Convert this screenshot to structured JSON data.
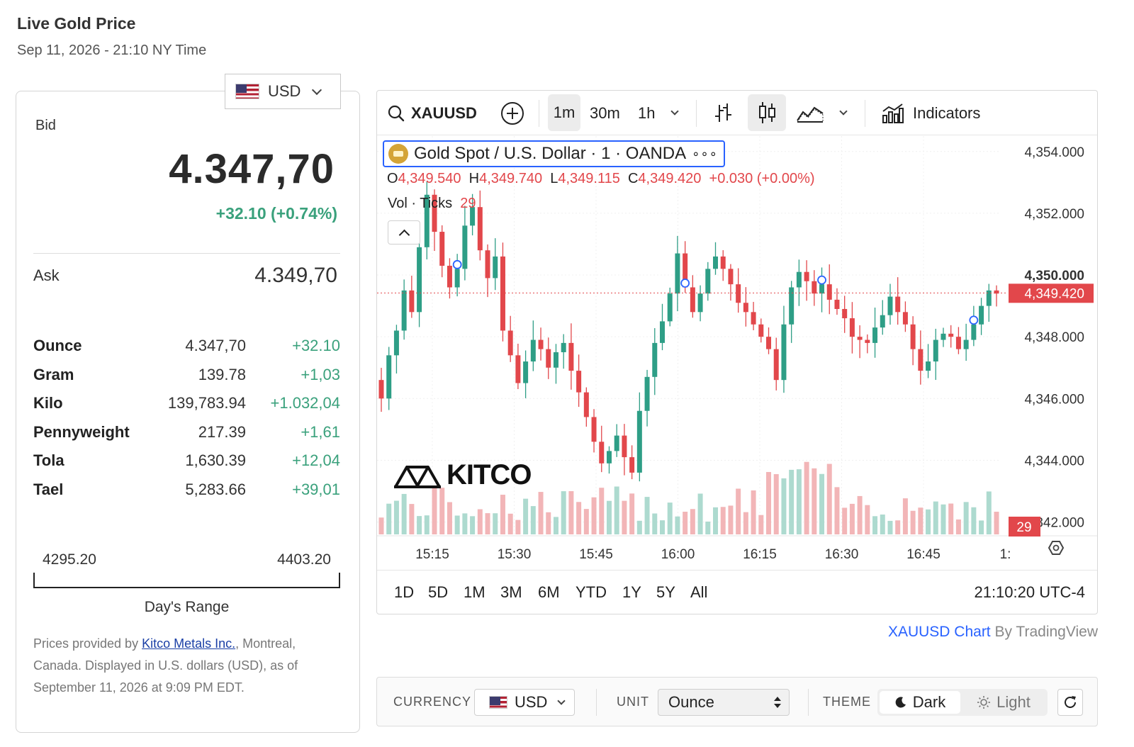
{
  "header": {
    "title": "Live Gold Price",
    "datetime": "Sep 11, 2026 - 21:10 NY Time"
  },
  "currency_select": {
    "value": "USD"
  },
  "quote": {
    "bid_label": "Bid",
    "bid": "4.347,70",
    "change": "+32.10 (+0.74%)",
    "ask_label": "Ask",
    "ask": "4.349,70"
  },
  "units": [
    {
      "name": "Ounce",
      "price": "4.347,70",
      "change": "+32.10"
    },
    {
      "name": "Gram",
      "price": "139.78",
      "change": "+1,03"
    },
    {
      "name": "Kilo",
      "price": "139,783.94",
      "change": "+1.032,04"
    },
    {
      "name": "Pennyweight",
      "price": "217.39",
      "change": "+1,61"
    },
    {
      "name": "Tola",
      "price": "1,630.39",
      "change": "+12,04"
    },
    {
      "name": "Tael",
      "price": "5,283.66",
      "change": "+39,01"
    }
  ],
  "range": {
    "low": "4295.20",
    "high": "4403.20",
    "label": "Day's Range"
  },
  "footnote": {
    "pre": "Prices provided by ",
    "link": "Kitco Metals Inc.",
    "post": ", Montreal, Canada. Displayed in U.S. dollars (USD), as of September 11, 2026 at 9:09 PM EDT."
  },
  "chart_toolbar": {
    "symbol": "XAUUSD",
    "intervals": [
      "1m",
      "30m",
      "1h"
    ],
    "active_interval": "1m",
    "indicators_label": "Indicators"
  },
  "chart_legend": {
    "title": "Gold Spot / U.S. Dollar · 1 · OANDA",
    "more": "∘∘∘",
    "o": "4,349.540",
    "h": "4,349.740",
    "l": "4,349.115",
    "c": "4,349.420",
    "chg": "+0.030 (+0.00%)",
    "vol_label": "Vol · Ticks",
    "vol_value": "29"
  },
  "watermark": "KITCO",
  "range_buttons": [
    "1D",
    "5D",
    "1M",
    "3M",
    "6M",
    "YTD",
    "1Y",
    "5Y",
    "All"
  ],
  "clock": "21:10:20 UTC-4",
  "attribution": {
    "link": "XAUUSD Chart",
    "by": " By TradingView"
  },
  "controls": {
    "currency_label": "CURRENCY",
    "currency": "USD",
    "unit_label": "UNIT",
    "unit": "Ounce",
    "theme_label": "THEME",
    "dark": "Dark",
    "light": "Light"
  },
  "colors": {
    "up": "#2e9e86",
    "down": "#e2474b",
    "accent": "#2962ff",
    "positive_text": "#3aa17c"
  },
  "chart_data": {
    "type": "candlestick",
    "symbol": "XAUUSD",
    "interval": "1m",
    "y_ticks": [
      "4,354.000",
      "4,352.000",
      "4,350.000",
      "4,348.000",
      "4,346.000",
      "4,344.000",
      "4,342.000"
    ],
    "y_range": [
      4341.6,
      4354.5
    ],
    "x_ticks": [
      "15:15",
      "15:30",
      "15:45",
      "16:00",
      "16:15",
      "16:30",
      "16:45",
      "1:"
    ],
    "last_price": "4,349.420",
    "last_price_value": 4349.42,
    "last_volume": "29",
    "close_series": [
      4346.0,
      4347.4,
      4348.2,
      4349.5,
      4348.8,
      4350.9,
      4352.6,
      4351.4,
      4350.3,
      4349.6,
      4350.2,
      4351.6,
      4352.2,
      4350.8,
      4349.9,
      4350.6,
      4348.2,
      4347.4,
      4346.5,
      4347.2,
      4347.9,
      4347.6,
      4347.0,
      4347.5,
      4347.8,
      4346.9,
      4346.2,
      4345.4,
      4344.6,
      4343.9,
      4344.3,
      4344.8,
      4344.1,
      4343.6,
      4345.6,
      4346.7,
      4347.8,
      4348.5,
      4349.4,
      4350.7,
      4349.6,
      4348.8,
      4349.4,
      4350.2,
      4350.6,
      4350.2,
      4349.7,
      4349.1,
      4348.8,
      4348.4,
      4348.0,
      4347.6,
      4346.6,
      4348.4,
      4349.6,
      4350.1,
      4349.8,
      4349.4,
      4349.7,
      4349.2,
      4348.9,
      4348.6,
      4348.0,
      4347.9,
      4347.8,
      4348.3,
      4348.7,
      4349.3,
      4348.8,
      4348.4,
      4347.6,
      4346.9,
      4347.2,
      4347.9,
      4348.1,
      4348.0,
      4347.6,
      4347.9,
      4348.4,
      4349.0,
      4349.5,
      4349.4
    ]
  }
}
